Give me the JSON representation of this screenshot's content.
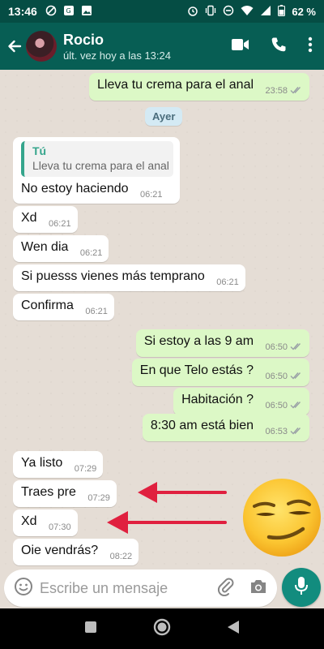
{
  "status_bar": {
    "time": "13:46",
    "battery": "62 %",
    "icons_left": [
      "dnd-slash-icon",
      "translate-icon",
      "image-icon"
    ],
    "icons_right": [
      "alarm-icon",
      "vibrate-icon",
      "minus-circle-icon",
      "wifi-icon",
      "signal-icon",
      "battery-icon"
    ]
  },
  "header": {
    "name": "Rocio",
    "last_seen": "últ. vez hoy a las 13:24"
  },
  "day_separator": "Ayer",
  "messages": [
    {
      "dir": "out",
      "text": "Lleva tu crema para el anal",
      "time": "23:58",
      "ticks": "read"
    },
    {
      "dir": "in",
      "quote_author": "Tú",
      "quote_text": "Lleva tu crema para el anal",
      "text": "No estoy haciendo",
      "time": "06:21"
    },
    {
      "dir": "in",
      "text": "Xd",
      "time": "06:21"
    },
    {
      "dir": "in",
      "text": "Wen dia",
      "time": "06:21"
    },
    {
      "dir": "in",
      "text": "Si puesss vienes más temprano",
      "time": "06:21"
    },
    {
      "dir": "in",
      "text": "Confirma",
      "time": "06:21"
    },
    {
      "dir": "out",
      "text": "Si estoy a las 9 am",
      "time": "06:50",
      "ticks": "read"
    },
    {
      "dir": "out",
      "text": "En que Telo estás ?",
      "time": "06:50",
      "ticks": "read"
    },
    {
      "dir": "out",
      "text": "Habitación ?",
      "time": "06:50",
      "ticks": "read"
    },
    {
      "dir": "out",
      "text": "8:30 am está bien",
      "time": "06:53",
      "ticks": "read"
    },
    {
      "dir": "in",
      "text": "Ya listo",
      "time": "07:29"
    },
    {
      "dir": "in",
      "text": "Traes pre",
      "time": "07:29"
    },
    {
      "dir": "in",
      "text": "Xd",
      "time": "07:30"
    },
    {
      "dir": "in",
      "text": "Oie vendrás?",
      "time": "08:22"
    }
  ],
  "overlay": {
    "arrows_color": "#e0203f",
    "emoji": "smirking-face-emoji"
  },
  "composer": {
    "placeholder": "Escribe un mensaje"
  },
  "colors": {
    "header": "#075e54",
    "outgoing_bubble": "#dcf8c6",
    "incoming_bubble": "#ffffff",
    "accent": "#128c7e",
    "read_ticks": "#34b7f1"
  }
}
